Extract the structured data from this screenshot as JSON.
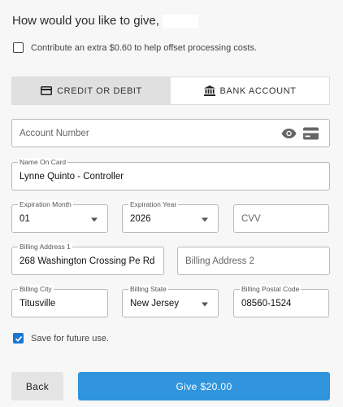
{
  "heading": "How would you like to give,",
  "extra_contribution": {
    "label": "Contribute an extra $0.60 to help offset processing costs.",
    "checked": false
  },
  "payment_tabs": [
    {
      "label": "Credit or Debit",
      "icon": "credit-card-icon",
      "active": true
    },
    {
      "label": "Bank Account",
      "icon": "bank-icon",
      "active": false
    }
  ],
  "account_number": {
    "placeholder": "Account Number",
    "value": ""
  },
  "name_on_card": {
    "label": "Name On Card",
    "value": "Lynne Quinto - Controller"
  },
  "expiration_month": {
    "label": "Expiration Month",
    "value": "01"
  },
  "expiration_year": {
    "label": "Expiration Year",
    "value": "2026"
  },
  "cvv": {
    "placeholder": "CVV",
    "value": ""
  },
  "billing_address_1": {
    "label": "Billing Address 1",
    "value": "268 Washington Crossing Pe Rd"
  },
  "billing_address_2": {
    "placeholder": "Billing Address 2",
    "value": ""
  },
  "billing_city": {
    "label": "Billing City",
    "value": "Titusville"
  },
  "billing_state": {
    "label": "Billing State",
    "value": "New Jersey"
  },
  "billing_postal": {
    "label": "Billing Postal Code",
    "value": "08560-1524"
  },
  "save_future": {
    "label": "Save for future use.",
    "checked": true
  },
  "buttons": {
    "back": "Back",
    "give": "Give $20.00"
  },
  "colors": {
    "primary": "#3095dd",
    "checkbox_checked": "#1976d2",
    "tab_active_bg": "#e0e0e0"
  }
}
